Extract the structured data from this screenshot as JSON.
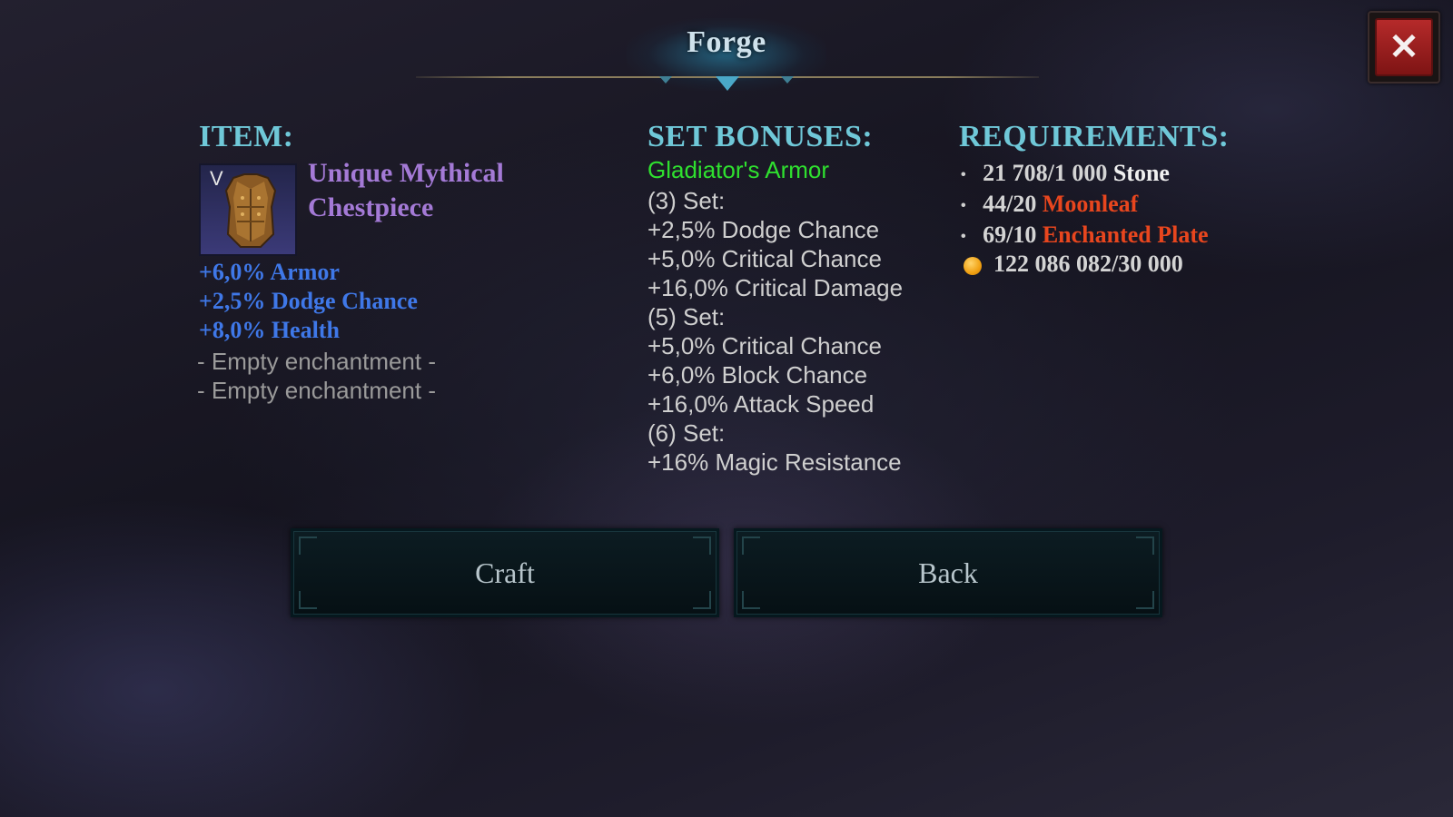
{
  "header": {
    "title": "Forge",
    "close_icon": "close-icon"
  },
  "item": {
    "heading": "ITEM:",
    "tier": "V",
    "icon": "chestpiece-icon",
    "name_line1": "Unique Mythical",
    "name_line2": "Chestpiece",
    "stats": [
      "+6,0% Armor",
      "+2,5% Dodge Chance",
      "+8,0% Health",
      "- Empty enchantment -",
      "- Empty enchantment -"
    ]
  },
  "set_bonuses": {
    "heading": "SET BONUSES:",
    "set_name": "Gladiator's Armor",
    "lines": [
      "(3) Set:",
      "+2,5% Dodge Chance",
      "+5,0% Critical Chance",
      "+16,0% Critical Damage",
      "(5) Set:",
      "+5,0% Critical Chance",
      "+6,0% Block Chance",
      "+16,0% Attack Speed",
      "(6) Set:",
      "+16% Magic Resistance"
    ]
  },
  "requirements": {
    "heading": "REQUIREMENTS:",
    "items": [
      {
        "amount": "21 708/1 000",
        "name": "Stone"
      },
      {
        "amount": "44/20",
        "name": "Moonleaf"
      },
      {
        "amount": "69/10",
        "name": "Enchanted Plate"
      }
    ],
    "gold": "122 086 082/30 000"
  },
  "buttons": {
    "craft": "Craft",
    "back": "Back"
  },
  "colors": {
    "heading": "#6fc8d8",
    "item_name": "#a47ad6",
    "stat_blue": "#3f78e8",
    "set_name": "#2fe02f",
    "requirement_met": "#f0f0f0",
    "requirement_red": "#e8461e",
    "close_red": "#b52a2a"
  }
}
